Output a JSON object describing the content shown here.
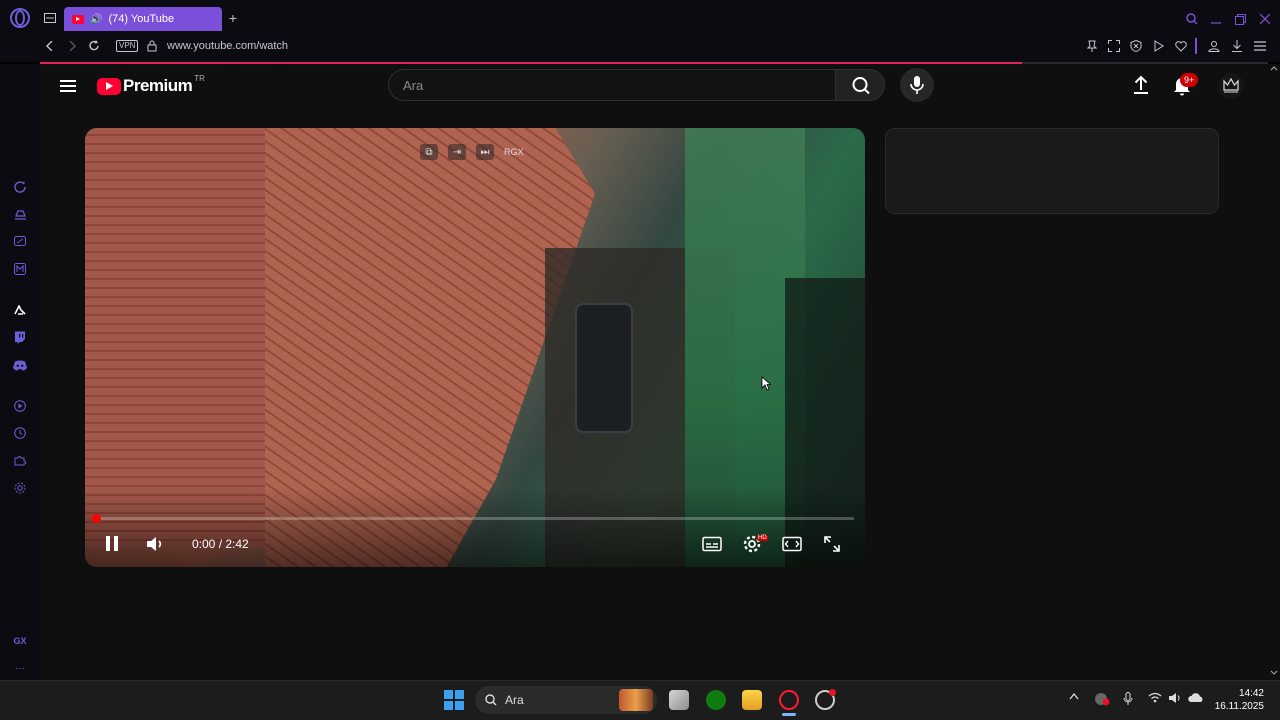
{
  "browser": {
    "tab_title": "(74) YouTube",
    "vpn_label": "VPN",
    "url": "www.youtube.com/watch"
  },
  "sidebar": {
    "gx_label": "GX",
    "more_label": "···"
  },
  "youtube": {
    "logo_text": "Premium",
    "country_code": "TR",
    "search_placeholder": "Ara",
    "notifications_badge": "9+"
  },
  "player": {
    "time": "0:00 / 2:42",
    "progress_fraction": 0.0,
    "top_overlay_label": "RGX",
    "hd_badge": "HD"
  },
  "taskbar": {
    "search_placeholder": "Ara",
    "time": "14:42",
    "date": "16.11.2025"
  },
  "colors": {
    "accent": "#7a4fd9",
    "youtube_red": "#ff0033",
    "loading_line": "#e0245e"
  }
}
